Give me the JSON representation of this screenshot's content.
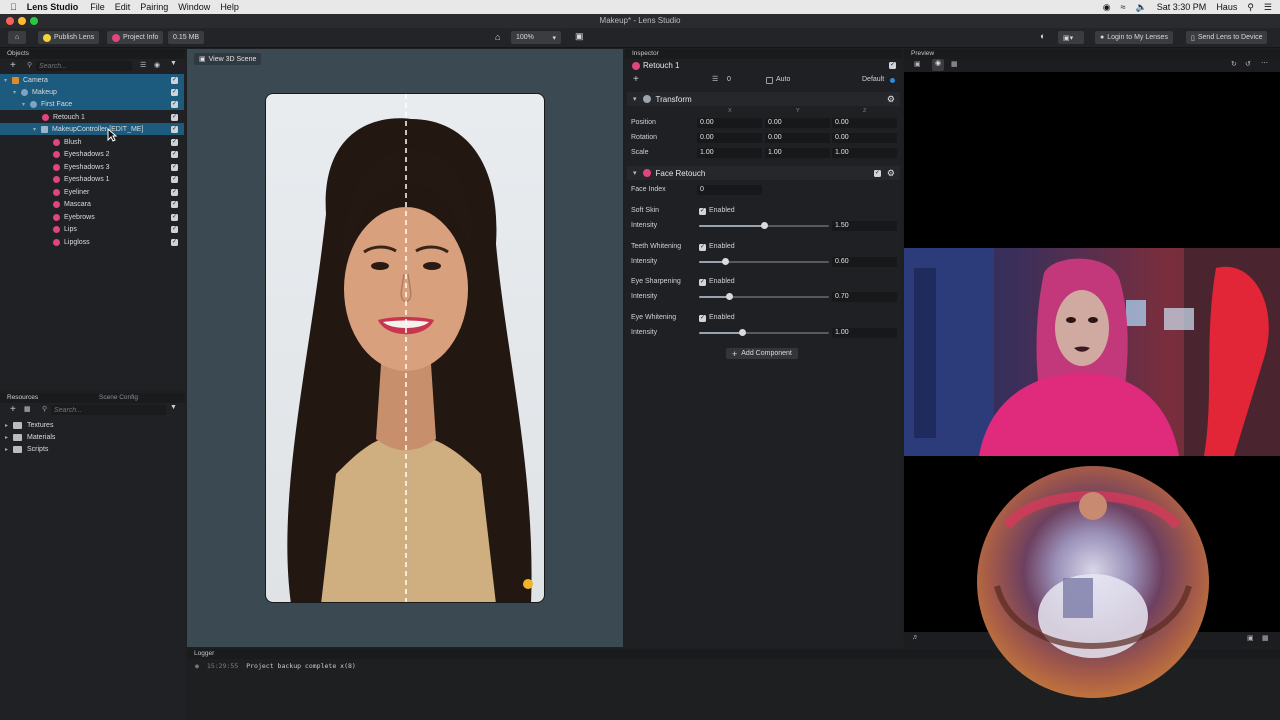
{
  "menubar": {
    "app": "Lens Studio",
    "menus": [
      "File",
      "Edit",
      "Pairing",
      "Window",
      "Help"
    ],
    "window_title": "Makeup* - Lens Studio",
    "clock": "Sat 3:30 PM",
    "user": "Haus"
  },
  "toolbar": {
    "publish": "Publish Lens",
    "project_info": "Project Info",
    "size": "0.15 MB",
    "zoom": "100%",
    "login": "Login to My Lenses",
    "send": "Send Lens to Device"
  },
  "objects": {
    "title": "Objects",
    "search_placeholder": "Search...",
    "items": [
      {
        "label": "Camera",
        "icon_color": "#e08a2c"
      },
      {
        "label": "Makeup",
        "icon_color": "#7fa3c2"
      },
      {
        "label": "First Face",
        "icon_color": "#7fa3c2"
      },
      {
        "label": "Retouch 1",
        "icon_color": "#e0457b"
      },
      {
        "label": "MakeupController [EDIT_ME]",
        "icon_color": "#7fa3c2"
      },
      {
        "label": "Blush",
        "icon_color": "#e0457b"
      },
      {
        "label": "Eyeshadows 2",
        "icon_color": "#e0457b"
      },
      {
        "label": "Eyeshadows 3",
        "icon_color": "#e0457b"
      },
      {
        "label": "Eyeshadows 1",
        "icon_color": "#e0457b"
      },
      {
        "label": "Eyeliner",
        "icon_color": "#e0457b"
      },
      {
        "label": "Mascara",
        "icon_color": "#e0457b"
      },
      {
        "label": "Eyebrows",
        "icon_color": "#e0457b"
      },
      {
        "label": "Lips",
        "icon_color": "#e0457b"
      },
      {
        "label": "Lipgloss",
        "icon_color": "#e0457b"
      }
    ]
  },
  "resources": {
    "tab1": "Resources",
    "tab2": "Scene Config",
    "search_placeholder": "Search...",
    "folders": [
      "Textures",
      "Materials",
      "Scripts"
    ]
  },
  "scene": {
    "view3d": "View 3D Scene"
  },
  "logger": {
    "title": "Logger",
    "time": "15:29:55",
    "message": "Project backup complete x(8)"
  },
  "inspector": {
    "title": "Inspector",
    "object_name": "Retouch 1",
    "layer_value": "0",
    "auto": "Auto",
    "default": "Default",
    "transform": {
      "title": "Transform",
      "axes": [
        "X",
        "Y",
        "Z"
      ],
      "position_label": "Position",
      "rotation_label": "Rotation",
      "scale_label": "Scale",
      "position": [
        "0.00",
        "0.00",
        "0.00"
      ],
      "rotation": [
        "0.00",
        "0.00",
        "0.00"
      ],
      "scale": [
        "1.00",
        "1.00",
        "1.00"
      ]
    },
    "face_retouch": {
      "title": "Face Retouch",
      "face_index_label": "Face Index",
      "face_index": "0",
      "enabled": "Enabled",
      "intensity_label": "Intensity",
      "sections": [
        {
          "label": "Soft Skin",
          "value": "1.50",
          "fraction": 0.5
        },
        {
          "label": "Teeth Whitening",
          "value": "0.60",
          "fraction": 0.2
        },
        {
          "label": "Eye Sharpening",
          "value": "0.70",
          "fraction": 0.233
        },
        {
          "label": "Eye Whitening",
          "value": "1.00",
          "fraction": 0.333
        }
      ]
    },
    "add_component": "Add Component"
  },
  "preview": {
    "title": "Preview"
  },
  "colors": {
    "accent": "#1c5a7e",
    "viewport_bg": "#3b4a52",
    "selection_blue": "#2b8be0"
  }
}
